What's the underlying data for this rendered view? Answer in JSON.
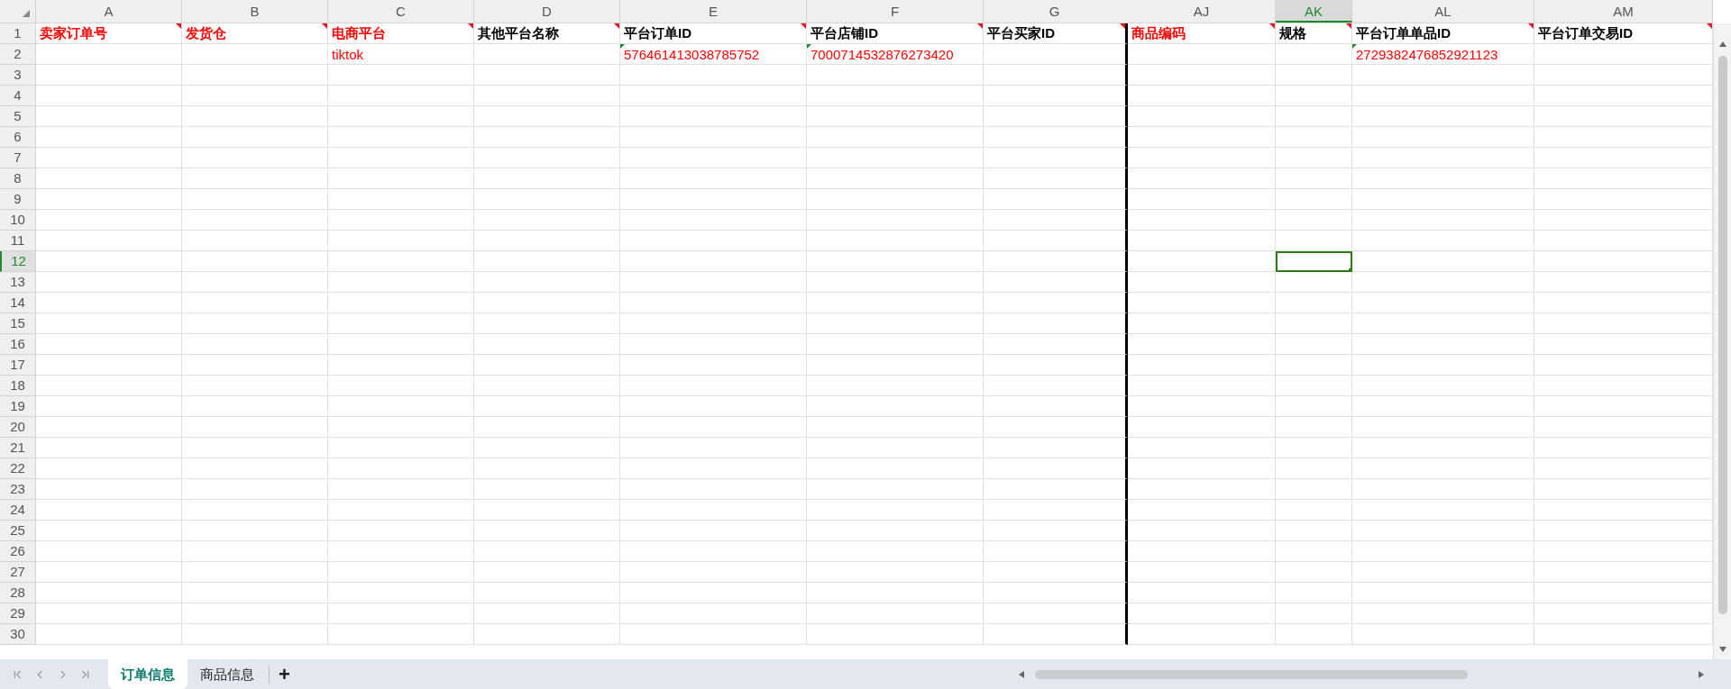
{
  "columns": [
    {
      "letter": "A",
      "selected": false,
      "frozen_edge": false
    },
    {
      "letter": "B",
      "selected": false,
      "frozen_edge": false
    },
    {
      "letter": "C",
      "selected": false,
      "frozen_edge": false
    },
    {
      "letter": "D",
      "selected": false,
      "frozen_edge": false
    },
    {
      "letter": "E",
      "selected": false,
      "frozen_edge": false
    },
    {
      "letter": "F",
      "selected": false,
      "frozen_edge": false
    },
    {
      "letter": "G",
      "selected": false,
      "frozen_edge": true
    },
    {
      "letter": "AJ",
      "selected": false,
      "frozen_edge": false
    },
    {
      "letter": "AK",
      "selected": true,
      "frozen_edge": false
    },
    {
      "letter": "AL",
      "selected": false,
      "frozen_edge": false
    },
    {
      "letter": "AM",
      "selected": false,
      "frozen_edge": false
    }
  ],
  "rows": [
    {
      "number": "1",
      "selected": false,
      "header": true,
      "cells": [
        {
          "text": "卖家订单号",
          "color": "#ff0000",
          "comment": true
        },
        {
          "text": "发货仓",
          "color": "#ff0000",
          "comment": true
        },
        {
          "text": "电商平台",
          "color": "#ff0000",
          "comment": true
        },
        {
          "text": "其他平台名称",
          "color": "#000000",
          "comment": true
        },
        {
          "text": "平台订单ID",
          "color": "#000000",
          "comment": true
        },
        {
          "text": "平台店铺ID",
          "color": "#000000",
          "comment": true
        },
        {
          "text": "平台买家ID",
          "color": "#000000",
          "comment": true
        },
        {
          "text": "商品编码",
          "color": "#ff0000",
          "comment": true
        },
        {
          "text": "规格",
          "color": "#000000",
          "comment": true
        },
        {
          "text": "平台订单单品ID",
          "color": "#000000",
          "comment": true
        },
        {
          "text": "平台订单交易ID",
          "color": "#000000",
          "comment": true
        }
      ]
    },
    {
      "number": "2",
      "selected": false,
      "cells": [
        {},
        {},
        {
          "text": "tiktok",
          "color": "#ff0000"
        },
        {},
        {
          "text": "576461413038785752",
          "color": "#ff0000",
          "number_as_text": true
        },
        {
          "text": "7000714532876273420",
          "color": "#ff0000",
          "number_as_text": true
        },
        {},
        {},
        {},
        {
          "text": "2729382476852921123",
          "color": "#ff0000",
          "number_as_text": true
        },
        {}
      ]
    },
    {
      "number": "3",
      "selected": false
    },
    {
      "number": "4",
      "selected": false
    },
    {
      "number": "5",
      "selected": false
    },
    {
      "number": "6",
      "selected": false
    },
    {
      "number": "7",
      "selected": false
    },
    {
      "number": "8",
      "selected": false
    },
    {
      "number": "9",
      "selected": false
    },
    {
      "number": "10",
      "selected": false
    },
    {
      "number": "11",
      "selected": false
    },
    {
      "number": "12",
      "selected": true
    },
    {
      "number": "13",
      "selected": false
    },
    {
      "number": "14",
      "selected": false
    },
    {
      "number": "15",
      "selected": false
    },
    {
      "number": "16",
      "selected": false
    },
    {
      "number": "17",
      "selected": false
    },
    {
      "number": "18",
      "selected": false
    },
    {
      "number": "19",
      "selected": false
    },
    {
      "number": "20",
      "selected": false
    },
    {
      "number": "21",
      "selected": false
    },
    {
      "number": "22",
      "selected": false
    },
    {
      "number": "23",
      "selected": false
    },
    {
      "number": "24",
      "selected": false
    },
    {
      "number": "25",
      "selected": false
    },
    {
      "number": "26",
      "selected": false
    },
    {
      "number": "27",
      "selected": false
    },
    {
      "number": "28",
      "selected": false
    },
    {
      "number": "29",
      "selected": false
    },
    {
      "number": "30",
      "selected": false
    }
  ],
  "sheet_tabs": [
    {
      "label": "订单信息",
      "selected": true
    },
    {
      "label": "商品信息",
      "selected": false
    }
  ],
  "add_sheet": "+"
}
